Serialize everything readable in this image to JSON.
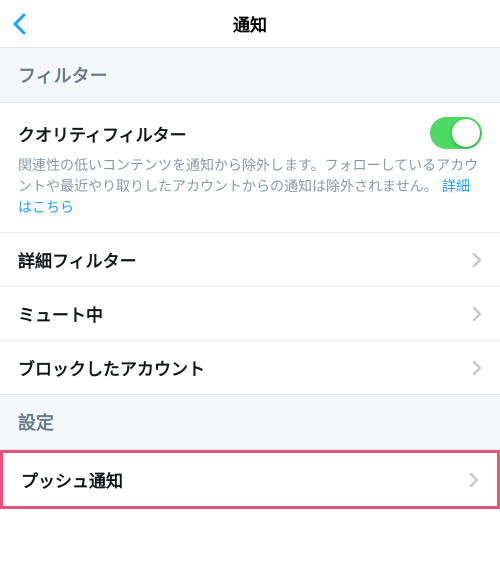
{
  "header": {
    "title": "通知"
  },
  "sections": {
    "filter": {
      "title": "フィルター",
      "quality": {
        "label": "クオリティフィルター",
        "description": "関連性の低いコンテンツを通知から除外します。フォローしているアカウントや最近やり取りしたアカウントからの通知は除外されません。",
        "link": "詳細はこちら",
        "toggle": true
      },
      "items": [
        {
          "label": "詳細フィルター"
        },
        {
          "label": "ミュート中"
        },
        {
          "label": "ブロックしたアカウント"
        }
      ]
    },
    "settings": {
      "title": "設定",
      "items": [
        {
          "label": "プッシュ通知",
          "highlighted": true
        }
      ]
    }
  },
  "colors": {
    "accent": "#1da1f2",
    "toggle_on": "#4cd964",
    "highlight": "#e6537a"
  }
}
